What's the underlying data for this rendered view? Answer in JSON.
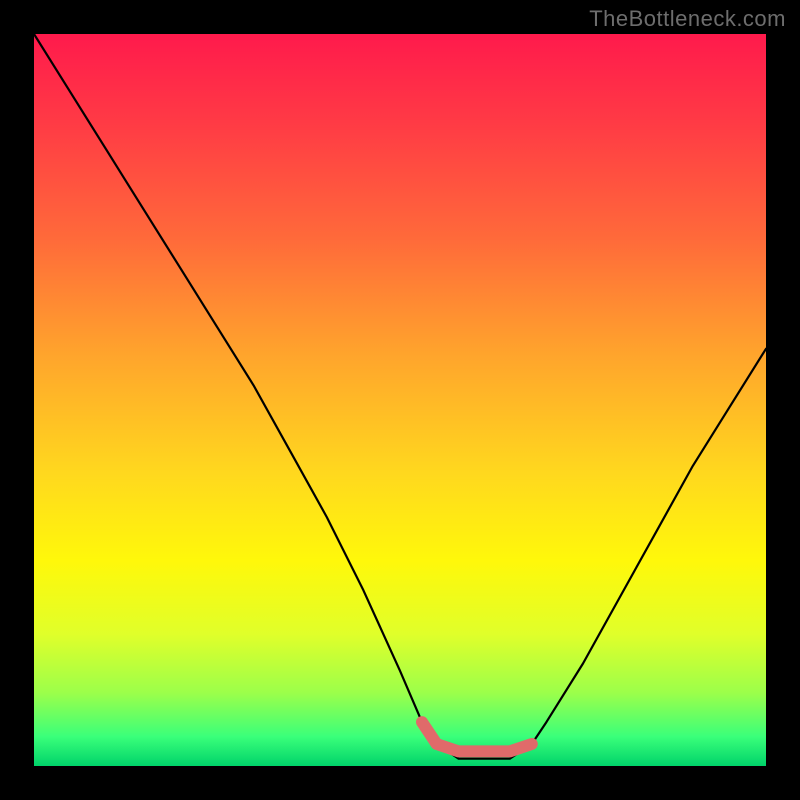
{
  "watermark": "TheBottleneck.com",
  "chart_data": {
    "type": "line",
    "title": "",
    "xlabel": "",
    "ylabel": "",
    "xlim": [
      0,
      100
    ],
    "ylim": [
      0,
      100
    ],
    "series": [
      {
        "name": "bottleneck-curve",
        "x": [
          0,
          5,
          10,
          15,
          20,
          25,
          30,
          35,
          40,
          45,
          50,
          53,
          55,
          58,
          62,
          65,
          68,
          70,
          75,
          80,
          85,
          90,
          95,
          100
        ],
        "y": [
          100,
          92,
          84,
          76,
          68,
          60,
          52,
          43,
          34,
          24,
          13,
          6,
          3,
          1,
          1,
          1,
          3,
          6,
          14,
          23,
          32,
          41,
          49,
          57
        ]
      }
    ],
    "annotations": [
      {
        "name": "trough-band",
        "x_start": 53,
        "x_end": 68,
        "y": 2
      }
    ],
    "gradient_stops": [
      {
        "pct": 0,
        "color": "#ff1a4c"
      },
      {
        "pct": 12,
        "color": "#ff3a45"
      },
      {
        "pct": 28,
        "color": "#ff6a3a"
      },
      {
        "pct": 44,
        "color": "#ffa52c"
      },
      {
        "pct": 60,
        "color": "#ffd81e"
      },
      {
        "pct": 72,
        "color": "#fff80a"
      },
      {
        "pct": 82,
        "color": "#e0ff2a"
      },
      {
        "pct": 90,
        "color": "#9cff4a"
      },
      {
        "pct": 96,
        "color": "#3aff7a"
      },
      {
        "pct": 100,
        "color": "#00d36a"
      }
    ]
  }
}
